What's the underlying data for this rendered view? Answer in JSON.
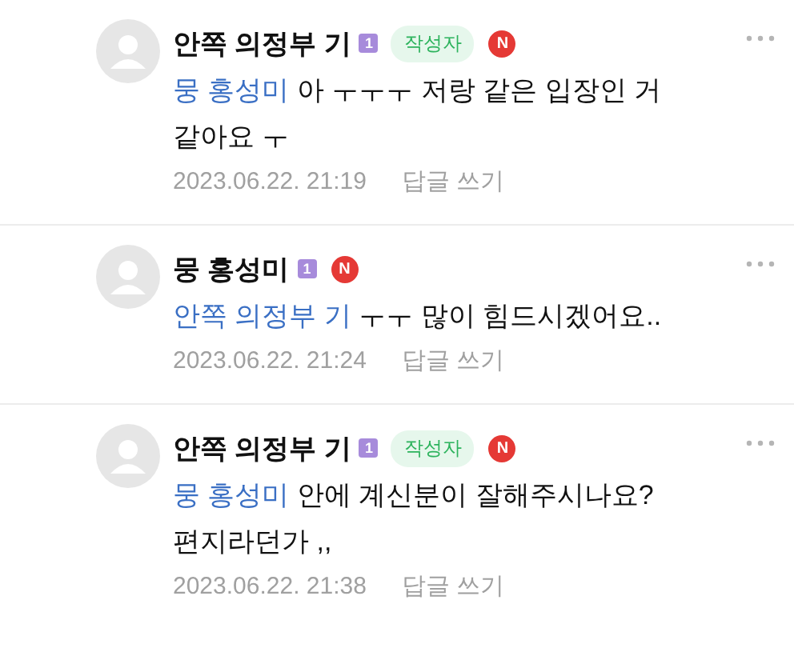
{
  "comments": [
    {
      "author": "안쪽 의정부 기",
      "level": "1",
      "writer_badge": "작성자",
      "new_badge": "N",
      "mention": "뭉 홍성미",
      "text": "아 ㅜㅜㅜ 저랑 같은 입장인 거 같아요 ㅜ",
      "date": "2023.06.22. 21:19",
      "reply": "답글 쓰기"
    },
    {
      "author": "뭉 홍성미",
      "level": "1",
      "new_badge": "N",
      "mention": "안쪽 의정부 기",
      "text": "ㅜㅜ 많이 힘드시겠어요..",
      "date": "2023.06.22. 21:24",
      "reply": "답글 쓰기"
    },
    {
      "author": "안쪽 의정부 기",
      "level": "1",
      "writer_badge": "작성자",
      "new_badge": "N",
      "mention": "뭉 홍성미",
      "text": "안에 계신분이 잘해주시나요? 편지라던가 ,,",
      "date": "2023.06.22. 21:38",
      "reply": "답글 쓰기"
    }
  ]
}
